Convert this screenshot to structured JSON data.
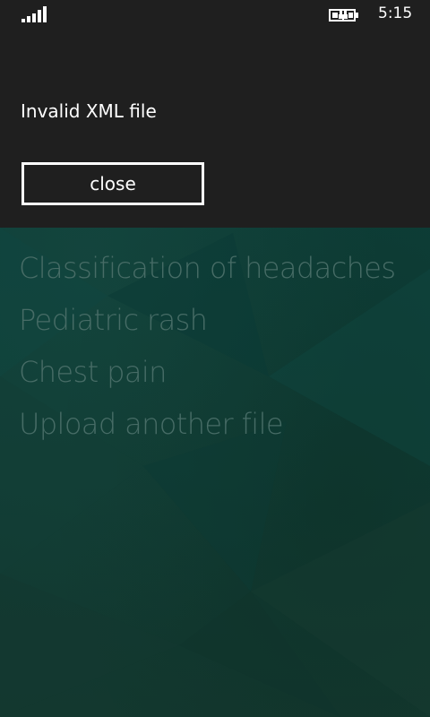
{
  "status_bar": {
    "time": "5:15",
    "signal_icon": "signal-bars-icon",
    "battery_icon": "battery-charging-icon"
  },
  "dialog": {
    "message": "Invalid XML file",
    "close_label": "close"
  },
  "menu": {
    "items": [
      {
        "label": "Classification of headaches"
      },
      {
        "label": "Pediatric rash"
      },
      {
        "label": "Chest pain"
      },
      {
        "label": "Upload another file"
      }
    ]
  },
  "colors": {
    "dialog_bg": "#1f1f1f",
    "page_bg": "#0d3d38",
    "menu_text": "#476c66",
    "white": "#ffffff"
  }
}
